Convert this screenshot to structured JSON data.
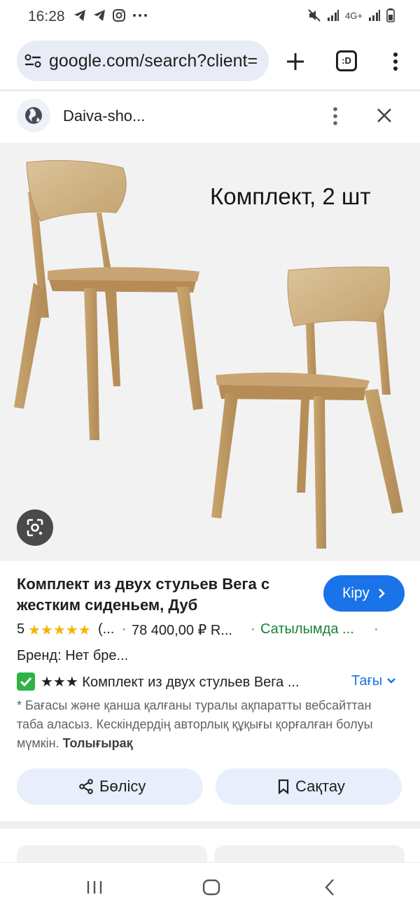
{
  "status_bar": {
    "time": "16:28",
    "left_icons": [
      "telegram-icon",
      "telegram-icon",
      "instagram-icon",
      "more-dots-icon"
    ],
    "network": "4G+"
  },
  "browser": {
    "url": "google.com/search?client=",
    "tabs_label": ":D"
  },
  "site": {
    "name": "Daiva-sho..."
  },
  "image": {
    "caption": "Комплект, 2 шт"
  },
  "product": {
    "title": "Комплект из двух стульев Вега с жестким сиденьем, Дуб",
    "visit_label": "Кіру",
    "rating": "5",
    "stars": "★★★★★",
    "reviews": "(...",
    "price": "78 400,00 ₽ R...",
    "availability": "Сатылымда ...",
    "brand": "Бренд: Нет бре...",
    "description": "★★★ Комплект из двух стульев Вега ...",
    "more_label": "Тағы",
    "disclaimer": "* Бағасы және қанша қалғаны туралы ақпаратты вебсайттан таба аласыз. Кескіндердің авторлық құқығы қорғалған болуы мүмкін.",
    "learn_more": "Толығырақ"
  },
  "actions": {
    "share_label": "Бөлісу",
    "save_label": "Сақтау"
  },
  "colors": {
    "accent": "#1a73e8",
    "star": "#f5b400",
    "in_stock": "#188038",
    "action_bg": "#e8eefb"
  }
}
